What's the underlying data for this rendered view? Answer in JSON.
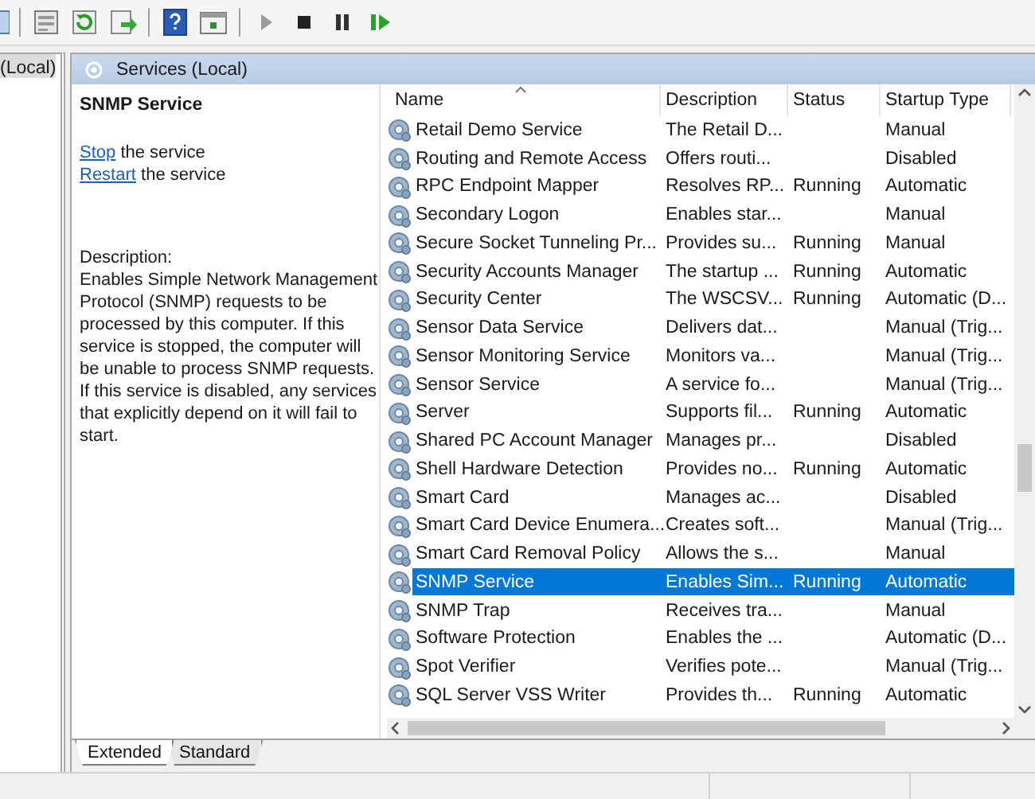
{
  "tree": {
    "label": "(Local)"
  },
  "panel": {
    "title": "Services (Local)"
  },
  "detail": {
    "title": "SNMP Service",
    "actions": [
      {
        "link": "Stop",
        "text": "the service"
      },
      {
        "link": "Restart",
        "text": "the service"
      }
    ],
    "description_label": "Description:",
    "description": "Enables Simple Network Management Protocol (SNMP) requests to be processed by this computer. If this service is stopped, the computer will be unable to process SNMP requests. If this service is disabled, any services that explicitly depend on it will fail to start."
  },
  "table": {
    "columns": [
      "Name",
      "Description",
      "Status",
      "Startup Type"
    ],
    "rows": [
      {
        "name": "Retail Demo Service",
        "description": "The Retail D...",
        "status": "",
        "startup": "Manual",
        "selected": false
      },
      {
        "name": "Routing and Remote Access",
        "description": "Offers routi...",
        "status": "",
        "startup": "Disabled",
        "selected": false
      },
      {
        "name": "RPC Endpoint Mapper",
        "description": "Resolves RP...",
        "status": "Running",
        "startup": "Automatic",
        "selected": false
      },
      {
        "name": "Secondary Logon",
        "description": "Enables star...",
        "status": "",
        "startup": "Manual",
        "selected": false
      },
      {
        "name": "Secure Socket Tunneling Pr...",
        "description": "Provides su...",
        "status": "Running",
        "startup": "Manual",
        "selected": false
      },
      {
        "name": "Security Accounts Manager",
        "description": "The startup ...",
        "status": "Running",
        "startup": "Automatic",
        "selected": false
      },
      {
        "name": "Security Center",
        "description": "The WSCSV...",
        "status": "Running",
        "startup": "Automatic (D...",
        "selected": false
      },
      {
        "name": "Sensor Data Service",
        "description": "Delivers dat...",
        "status": "",
        "startup": "Manual (Trig...",
        "selected": false
      },
      {
        "name": "Sensor Monitoring Service",
        "description": "Monitors va...",
        "status": "",
        "startup": "Manual (Trig...",
        "selected": false
      },
      {
        "name": "Sensor Service",
        "description": "A service fo...",
        "status": "",
        "startup": "Manual (Trig...",
        "selected": false
      },
      {
        "name": "Server",
        "description": "Supports fil...",
        "status": "Running",
        "startup": "Automatic",
        "selected": false
      },
      {
        "name": "Shared PC Account Manager",
        "description": "Manages pr...",
        "status": "",
        "startup": "Disabled",
        "selected": false
      },
      {
        "name": "Shell Hardware Detection",
        "description": "Provides no...",
        "status": "Running",
        "startup": "Automatic",
        "selected": false
      },
      {
        "name": "Smart Card",
        "description": "Manages ac...",
        "status": "",
        "startup": "Disabled",
        "selected": false
      },
      {
        "name": "Smart Card Device Enumera...",
        "description": "Creates soft...",
        "status": "",
        "startup": "Manual (Trig...",
        "selected": false
      },
      {
        "name": "Smart Card Removal Policy",
        "description": "Allows the s...",
        "status": "",
        "startup": "Manual",
        "selected": false
      },
      {
        "name": "SNMP Service",
        "description": "Enables Sim...",
        "status": "Running",
        "startup": "Automatic",
        "selected": true
      },
      {
        "name": "SNMP Trap",
        "description": "Receives tra...",
        "status": "",
        "startup": "Manual",
        "selected": false
      },
      {
        "name": "Software Protection",
        "description": "Enables the ...",
        "status": "",
        "startup": "Automatic (D...",
        "selected": false
      },
      {
        "name": "Spot Verifier",
        "description": "Verifies pote...",
        "status": "",
        "startup": "Manual (Trig...",
        "selected": false
      },
      {
        "name": "SQL Server VSS Writer",
        "description": "Provides th...",
        "status": "Running",
        "startup": "Automatic",
        "selected": false
      }
    ]
  },
  "tabs": [
    {
      "label": "Extended",
      "selected": true
    },
    {
      "label": "Standard",
      "selected": false
    }
  ]
}
